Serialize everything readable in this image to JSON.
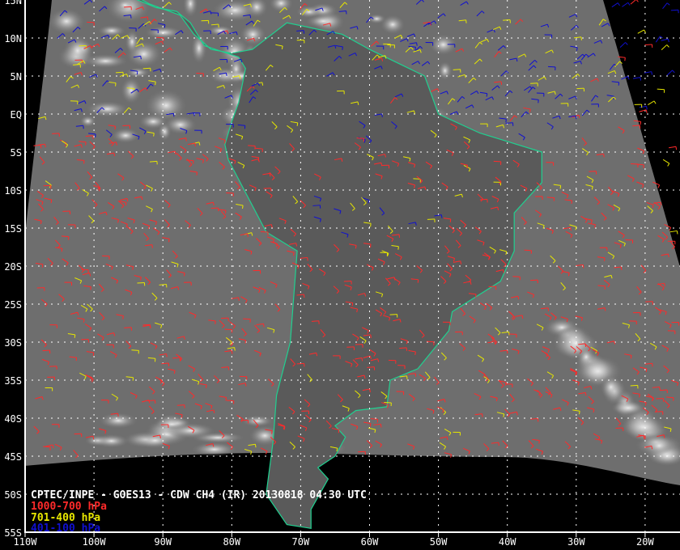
{
  "title": "CPTEC/INPE - GOES13 - CDW CH4 (IR) 20130818 04:30 UTC",
  "legend": [
    {
      "label": "1000-700 hPa",
      "color": "#ff2a2a"
    },
    {
      "label": "701-400 hPa",
      "color": "#e6e600"
    },
    {
      "label": "401-100 hPa",
      "color": "#1010d0"
    }
  ],
  "map": {
    "lon_range": [
      -110,
      -15
    ],
    "lat_range": [
      -55,
      15
    ],
    "grid": "dotted",
    "coastline_color": "#20d090",
    "lat_labels": [
      "15N",
      "10N",
      "5N",
      "EQ",
      "5S",
      "10S",
      "15S",
      "20S",
      "25S",
      "30S",
      "35S",
      "40S",
      "45S",
      "50S",
      "55S"
    ],
    "lon_labels": [
      "110W",
      "100W",
      "90W",
      "80W",
      "70W",
      "60W",
      "50W",
      "40W",
      "30W",
      "20W"
    ]
  }
}
